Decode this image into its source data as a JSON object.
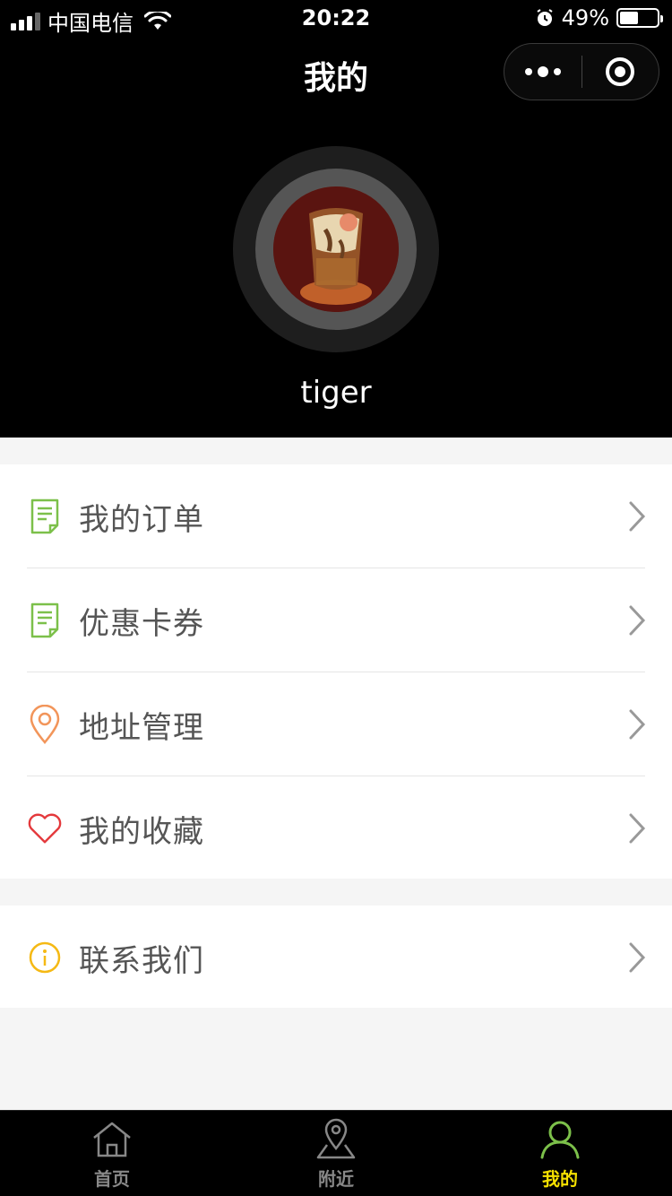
{
  "status_bar": {
    "carrier": "中国电信",
    "time": "20:22",
    "battery": "49%",
    "battery_level": 0.49
  },
  "nav": {
    "title": "我的"
  },
  "profile": {
    "username": "tiger"
  },
  "menu": {
    "group1": [
      {
        "label": "我的订单",
        "icon": "document-icon"
      },
      {
        "label": "优惠卡券",
        "icon": "document-icon"
      },
      {
        "label": "地址管理",
        "icon": "location-pin-icon"
      },
      {
        "label": "我的收藏",
        "icon": "heart-icon"
      }
    ],
    "group2": [
      {
        "label": "联系我们",
        "icon": "info-icon"
      }
    ]
  },
  "tabs": [
    {
      "label": "首页",
      "icon": "home-icon",
      "active": false
    },
    {
      "label": "附近",
      "icon": "map-pin-icon",
      "active": false
    },
    {
      "label": "我的",
      "icon": "user-icon",
      "active": true
    }
  ],
  "colors": {
    "green_icon": "#7cc04a",
    "orange_icon": "#f2955a",
    "red_icon": "#e4393c",
    "yellow_icon": "#f5b914",
    "tab_active": "#f5e000",
    "tab_active_icon": "#7cc04a"
  }
}
